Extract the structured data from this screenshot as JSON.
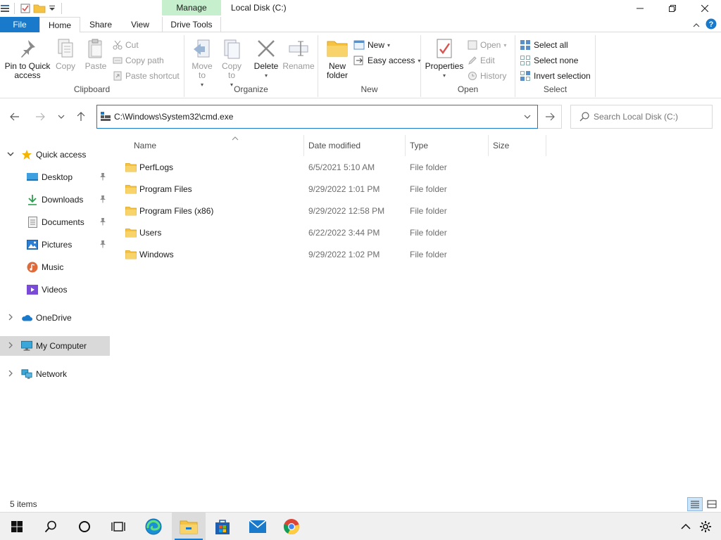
{
  "window": {
    "title": "Local Disk (C:)",
    "context_tab": "Manage"
  },
  "tabs": [
    {
      "label": "File"
    },
    {
      "label": "Home"
    },
    {
      "label": "Share"
    },
    {
      "label": "View"
    },
    {
      "label": "Drive Tools"
    }
  ],
  "ribbon": {
    "clipboard": {
      "label": "Clipboard",
      "pin": "Pin to Quick access",
      "copy": "Copy",
      "paste": "Paste",
      "cut": "Cut",
      "copy_path": "Copy path",
      "paste_shortcut": "Paste shortcut"
    },
    "organize": {
      "label": "Organize",
      "move_to": "Move to",
      "copy_to": "Copy to",
      "delete": "Delete",
      "rename": "Rename"
    },
    "new": {
      "label": "New",
      "new_folder": "New folder",
      "new_item": "New",
      "easy_access": "Easy access"
    },
    "open": {
      "label": "Open",
      "properties": "Properties",
      "open": "Open",
      "edit": "Edit",
      "history": "History"
    },
    "select": {
      "label": "Select",
      "select_all": "Select all",
      "select_none": "Select none",
      "invert": "Invert selection"
    }
  },
  "address": {
    "value": "C:\\Windows\\System32\\cmd.exe"
  },
  "search": {
    "placeholder": "Search Local Disk (C:)"
  },
  "nav": {
    "quick_access": "Quick access",
    "desktop": "Desktop",
    "downloads": "Downloads",
    "documents": "Documents",
    "pictures": "Pictures",
    "music": "Music",
    "videos": "Videos",
    "onedrive": "OneDrive",
    "my_computer": "My Computer",
    "network": "Network"
  },
  "columns": {
    "name": "Name",
    "date": "Date modified",
    "type": "Type",
    "size": "Size"
  },
  "files": [
    {
      "name": "PerfLogs",
      "date": "6/5/2021 5:10 AM",
      "type": "File folder"
    },
    {
      "name": "Program Files",
      "date": "9/29/2022 1:01 PM",
      "type": "File folder"
    },
    {
      "name": "Program Files (x86)",
      "date": "9/29/2022 12:58 PM",
      "type": "File folder"
    },
    {
      "name": "Users",
      "date": "6/22/2022 3:44 PM",
      "type": "File folder"
    },
    {
      "name": "Windows",
      "date": "9/29/2022 1:02 PM",
      "type": "File folder"
    }
  ],
  "status": {
    "items": "5 items"
  },
  "colors": {
    "accent": "#1979ca",
    "manage_tab": "#c6efce",
    "folder": "#f5c242",
    "selected_nav": "#d9d9d9"
  }
}
